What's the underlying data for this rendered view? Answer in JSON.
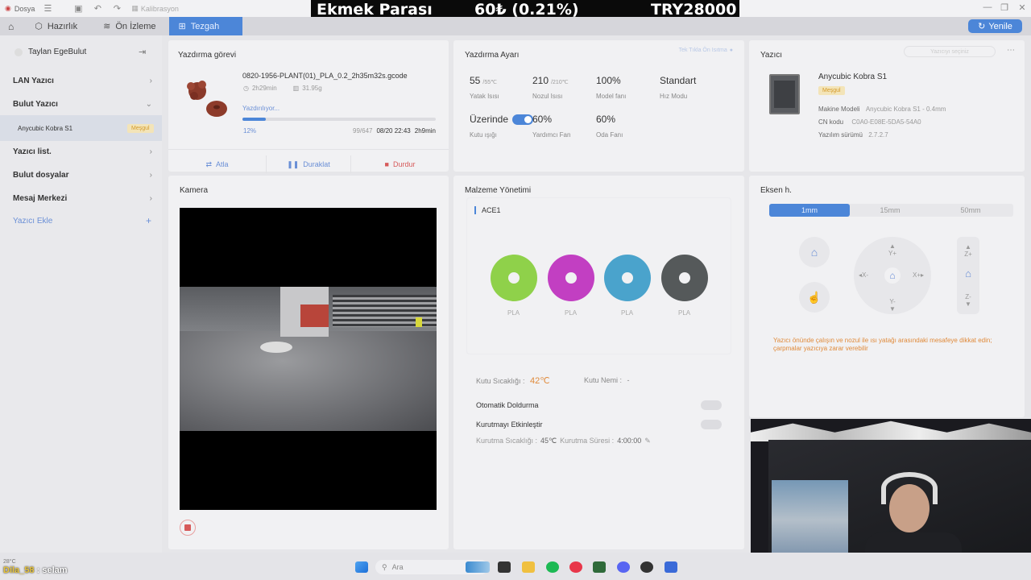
{
  "titlebar": {
    "file_menu": "Dosya",
    "calibration": "Kalibrasyon"
  },
  "overlay": {
    "left": "Ekmek Parası",
    "middle": "60₺ (0.21%)",
    "right": "TRY28000"
  },
  "tabs": [
    {
      "label": "Hazırlık"
    },
    {
      "label": "Ön İzleme"
    },
    {
      "label": "Tezgah"
    }
  ],
  "refresh_label": "Yenile",
  "sidebar": {
    "user_name": "Taylan EgeBulut",
    "lan_printer": "LAN Yazıcı",
    "cloud_printer": "Bulut Yazıcı",
    "printer_name": "Anycubic Kobra S1",
    "printer_status": "Meşgul",
    "printer_list": "Yazıcı list.",
    "cloud_files": "Bulut dosyalar",
    "message_center": "Mesaj Merkezi",
    "add_printer": "Yazıcı Ekle"
  },
  "job": {
    "title": "Yazdırma görevi",
    "filename": "0820-1956-PLANT(01)_PLA_0.2_2h35m32s.gcode",
    "duration": "2h29min",
    "weight": "31.95g",
    "status": "Yazdırılıyor...",
    "progress_label": "12%",
    "progress": 0.12,
    "layers": "99/647",
    "eta_clock": "08/20 22:43",
    "remaining": "2h9min",
    "skip_label": "Atla",
    "pause_label": "Duraklat",
    "stop_label": "Durdur"
  },
  "settings": {
    "title": "Yazdırma Ayarı",
    "header_link": "Tek Tıkla Ön Isıtma",
    "bed_temp": "55",
    "bed_target": "/55℃",
    "bed_label": "Yatak Isısı",
    "nozzle_temp": "210",
    "nozzle_target": "/210℃",
    "nozzle_label": "Nozul Isısı",
    "model_fan": "100%",
    "model_fan_label": "Model fanı",
    "speed_mode": "Standart",
    "speed_label": "Hız Modu",
    "light": "Üzerinde",
    "light_label": "Kutu ışığı",
    "aux_fan": "60%",
    "aux_fan_label": "Yardımcı Fan",
    "room_fan": "60%",
    "room_fan_label": "Oda Fanı"
  },
  "printer": {
    "title": "Yazıcı",
    "select_placeholder": "Yazıcıyı seçiniz",
    "name": "Anycubic Kobra S1",
    "status": "Meşgul",
    "model_label": "Makine Modeli",
    "model_value": "Anycubic Kobra S1 - 0.4mm",
    "cn_label": "CN kodu",
    "cn_value": "C0A0-E08E-5DA5-54A0",
    "fw_label": "Yazılım sürümü",
    "fw_value": "2.7.2.7"
  },
  "camera": {
    "title": "Kamera"
  },
  "material": {
    "title": "Malzeme Yönetimi",
    "unit": "ACE1",
    "spools": [
      {
        "type": "PLA",
        "color": "#8fd14a"
      },
      {
        "type": "PLA",
        "color": "#c23fc2"
      },
      {
        "type": "PLA",
        "color": "#4aa3cc"
      },
      {
        "type": "PLA",
        "color": "#55595a"
      }
    ],
    "box_temp_label": "Kutu Sıcaklığı :",
    "box_temp": "42℃",
    "humidity_label": "Kutu Nemi :",
    "humidity": "-",
    "auto_refill": "Otomatik Doldurma",
    "drying": "Kurutmayı Etkinleştir",
    "dry_temp_label": "Kurutma Sıcaklığı :",
    "dry_temp": "45℃",
    "dry_time_label": "Kurutma Süresi :",
    "dry_time": "4:00:00"
  },
  "axis": {
    "title": "Eksen h.",
    "steps": [
      "1mm",
      "15mm",
      "50mm"
    ],
    "y_plus": "Y+",
    "y_minus": "Y-",
    "x_plus": "X+",
    "x_minus": "X-",
    "z_plus": "Z+",
    "z_minus": "Z-",
    "warning": "Yazıcı önünde çalışın ve nozul ile ısı yatağı arasındaki mesafeye dikkat edin; çarpmalar yazıcıya zarar verebilir"
  },
  "stream": {
    "chat_user": "Dila_58",
    "chat_sep": ":",
    "chat_msg": "selam",
    "weather": "28°C"
  },
  "taskbar": {
    "search_placeholder": "Ara"
  }
}
